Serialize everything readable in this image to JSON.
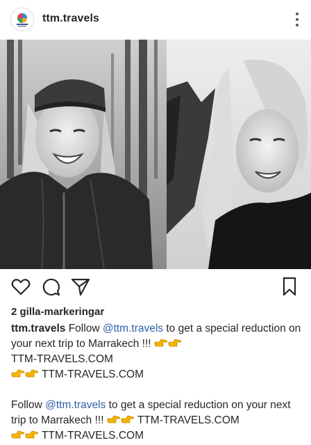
{
  "post": {
    "username": "ttm.travels",
    "likes_text": "2 gilla-markeringar"
  },
  "caption": {
    "username": "ttm.travels",
    "part1": "Follow ",
    "mention": "@ttm.travels",
    "part2": " to get a special reduction on your next trip to Marrakech !!! ",
    "link1": "TTM-TRAVELS.COM",
    "link2": "TTM-TRAVELS.COM",
    "para2_part1": "Follow ",
    "para2_mention": "@ttm.travels",
    "para2_part2": " to get a special reduction on your next trip to Marrakech !!! ",
    "para2_link1": "TTM-TRAVELS.COM",
    "para2_link2": "TTM-TRAVELS.COM"
  },
  "icons": {
    "like": "heart-icon",
    "comment": "comment-icon",
    "share": "send-icon",
    "save": "bookmark-icon",
    "more": "more-options-icon",
    "emoji": "backhand-index-pointing-right-emoji"
  },
  "colors": {
    "text": "#262626",
    "mention": "#2f5fa8",
    "emoji": "#f4b400"
  }
}
